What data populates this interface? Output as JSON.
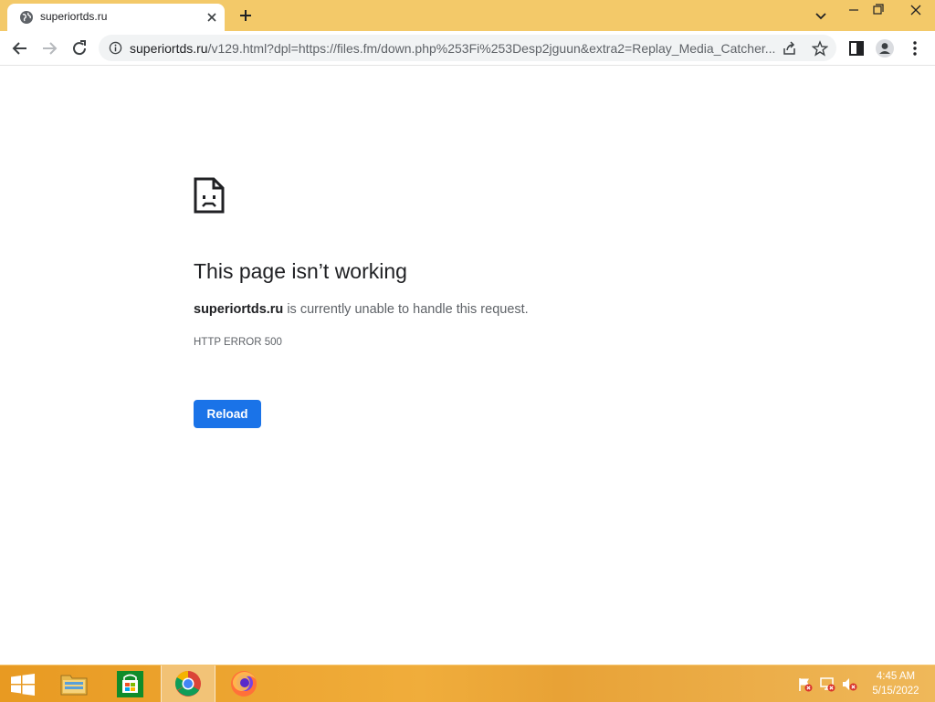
{
  "window": {
    "tab_title": "superiortds.ru",
    "minimize_label": "—",
    "restore_label": "❐",
    "close_label": "✕"
  },
  "omnibox": {
    "host": "superiortds.ru",
    "path": "/v129.html?dpl=https://files.fm/down.php%253Fi%253Desp2jguun&extra2=Replay_Media_Catcher..."
  },
  "error_page": {
    "title": "This page isn’t working",
    "host": "superiortds.ru",
    "description": " is currently unable to handle this request.",
    "code": "HTTP ERROR 500",
    "reload_label": "Reload"
  },
  "taskbar": {
    "items": [
      "start-icon",
      "file-explorer-icon",
      "store-icon",
      "chrome-icon",
      "firefox-icon"
    ],
    "tray": [
      "action-center-icon",
      "network-icon",
      "volume-muted-icon"
    ],
    "time": "4:45 AM",
    "date": "5/15/2022"
  },
  "colors": {
    "titlebar": "#f3c969",
    "accent_blue": "#1a73e8",
    "taskbar": "#f0ad3b"
  }
}
